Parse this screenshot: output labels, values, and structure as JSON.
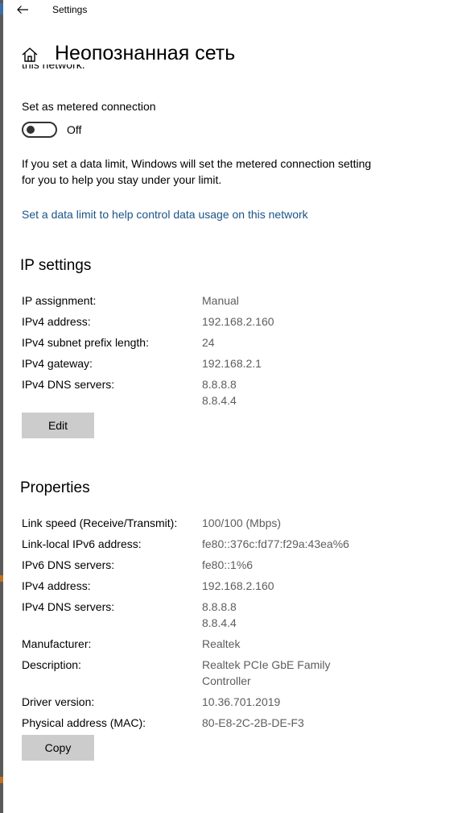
{
  "window": {
    "title": "Settings"
  },
  "header": {
    "title": "Неопознанная сеть"
  },
  "cut_text": "this network.",
  "metered": {
    "label": "Set as metered connection",
    "toggle_state": "Off",
    "info": "If you set a data limit, Windows will set the metered connection setting for you to help you stay under your limit.",
    "link": "Set a data limit to help control data usage on this network"
  },
  "ip_settings": {
    "title": "IP settings",
    "rows": [
      {
        "label": "IP assignment:",
        "value": "Manual"
      },
      {
        "label": "IPv4 address:",
        "value": "192.168.2.160"
      },
      {
        "label": "IPv4 subnet prefix length:",
        "value": "24"
      },
      {
        "label": "IPv4 gateway:",
        "value": "192.168.2.1"
      },
      {
        "label": "IPv4 DNS servers:",
        "value": "8.8.8.8",
        "value2": "8.8.4.4"
      }
    ],
    "edit_label": "Edit"
  },
  "properties": {
    "title": "Properties",
    "rows": [
      {
        "label": "Link speed (Receive/Transmit):",
        "value": "100/100 (Mbps)"
      },
      {
        "label": "Link-local IPv6 address:",
        "value": "fe80::376c:fd77:f29a:43ea%6"
      },
      {
        "label": "IPv6 DNS servers:",
        "value": "fe80::1%6"
      },
      {
        "label": "IPv4 address:",
        "value": "192.168.2.160"
      },
      {
        "label": "IPv4 DNS servers:",
        "value": "8.8.8.8",
        "value2": "8.8.4.4"
      },
      {
        "label": "Manufacturer:",
        "value": "Realtek"
      },
      {
        "label": "Description:",
        "value": "Realtek PCIe GbE Family",
        "value2": "Controller"
      },
      {
        "label": "Driver version:",
        "value": "10.36.701.2019"
      },
      {
        "label": "Physical address (MAC):",
        "value": "80-E8-2C-2B-DE-F3"
      }
    ],
    "copy_label": "Copy"
  },
  "icons": {
    "back": "back-arrow-icon",
    "home": "home-icon"
  }
}
